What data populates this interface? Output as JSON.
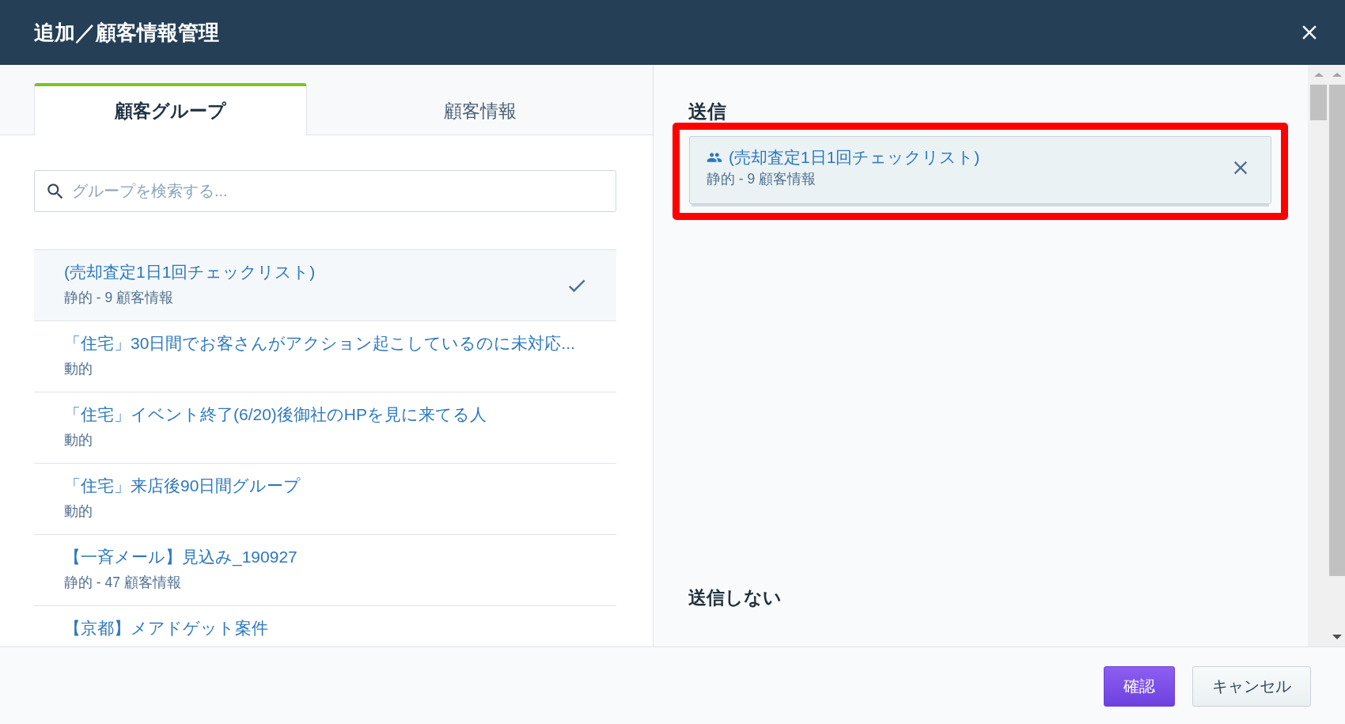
{
  "dialog": {
    "title": "追加／顧客情報管理"
  },
  "tabs": [
    {
      "label": "顧客グループ",
      "selected": true
    },
    {
      "label": "顧客情報",
      "selected": false
    }
  ],
  "search": {
    "placeholder": "グループを検索する..."
  },
  "groups": [
    {
      "name": "(売却査定1日1回チェックリスト)",
      "meta": "静的 - 9 顧客情報",
      "selected": true
    },
    {
      "name": "「住宅」30日間でお客さんがアクション起こしているのに未対応...",
      "meta": "動的",
      "selected": false
    },
    {
      "name": "「住宅」イベント終了(6/20)後御社のHPを見に来てる人",
      "meta": "動的",
      "selected": false
    },
    {
      "name": "「住宅」来店後90日間グループ",
      "meta": "動的",
      "selected": false
    },
    {
      "name": "【一斉メール】見込み_190927",
      "meta": "静的 - 47 顧客情報",
      "selected": false
    },
    {
      "name": "【京都】メアドゲット案件",
      "selected": false
    }
  ],
  "send": {
    "heading": "送信",
    "items": [
      {
        "name": "(売却査定1日1回チェックリスト)",
        "meta": "静的 - 9 顧客情報",
        "highlighted": true
      }
    ]
  },
  "exclude": {
    "heading": "送信しない"
  },
  "buttons": [
    {
      "label": "確認",
      "kind": "primary"
    },
    {
      "label": "キャンセル",
      "kind": "secondary"
    }
  ]
}
